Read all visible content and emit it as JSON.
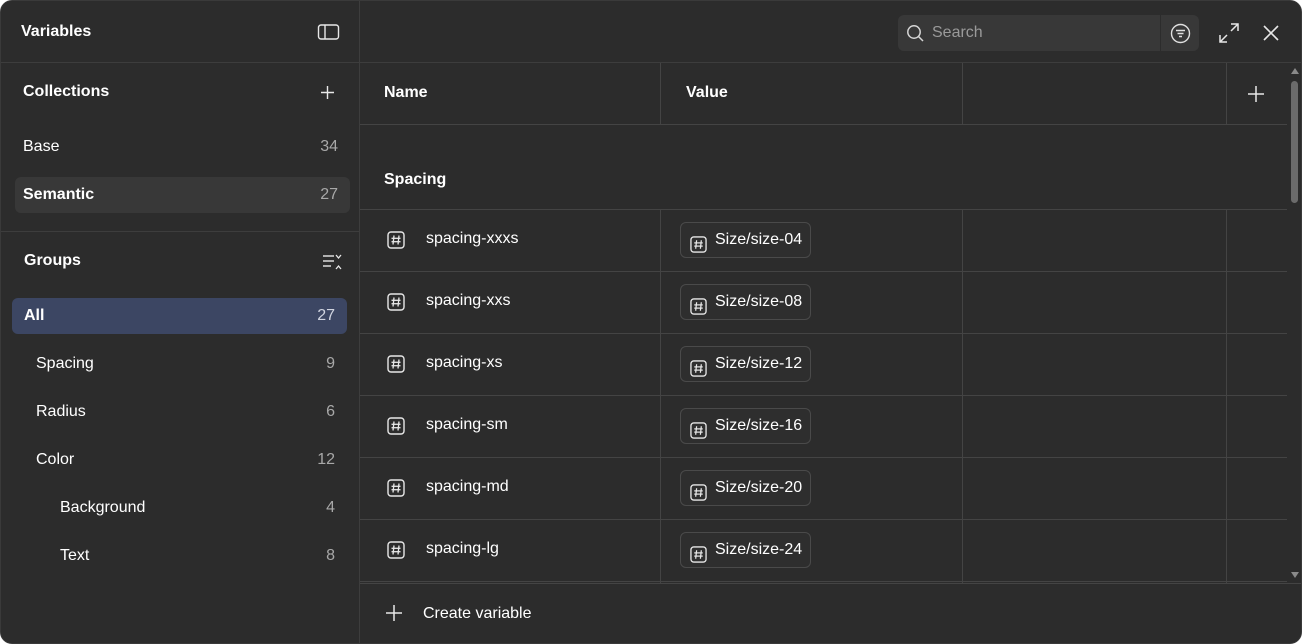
{
  "sidebar": {
    "title": "Variables",
    "collections": {
      "title": "Collections",
      "items": [
        {
          "label": "Base",
          "count": "34"
        },
        {
          "label": "Semantic",
          "count": "27"
        }
      ]
    },
    "groups": {
      "title": "Groups",
      "items": [
        {
          "label": "All",
          "count": "27"
        },
        {
          "label": "Spacing",
          "count": "9"
        },
        {
          "label": "Radius",
          "count": "6"
        },
        {
          "label": "Color",
          "count": "12"
        },
        {
          "label": "Background",
          "count": "4"
        },
        {
          "label": "Text",
          "count": "8"
        }
      ]
    }
  },
  "search": {
    "placeholder": "Search"
  },
  "table": {
    "columns": [
      "Name",
      "Value"
    ],
    "group_label": "Spacing",
    "rows": [
      {
        "name": "spacing-xxxs",
        "value": "Size/size-04"
      },
      {
        "name": "spacing-xxs",
        "value": "Size/size-08"
      },
      {
        "name": "spacing-xs",
        "value": "Size/size-12"
      },
      {
        "name": "spacing-sm",
        "value": "Size/size-16"
      },
      {
        "name": "spacing-md",
        "value": "Size/size-20"
      },
      {
        "name": "spacing-lg",
        "value": "Size/size-24"
      }
    ]
  },
  "footer": {
    "create_label": "Create variable"
  },
  "colors": {
    "panel": "#2c2c2c",
    "active_group": "#3c4663",
    "active_collection": "#383838",
    "border": "#444444"
  }
}
